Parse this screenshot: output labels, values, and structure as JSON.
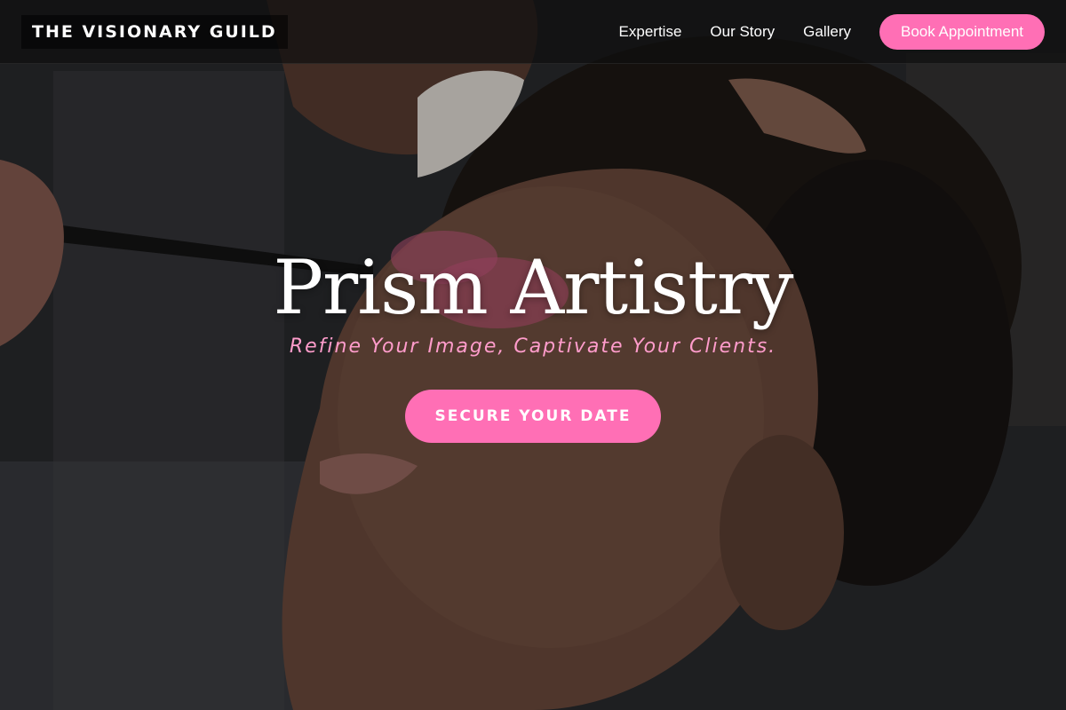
{
  "nav": {
    "brand": "THE VISIONARY GUILD",
    "links": [
      "Expertise",
      "Our Story",
      "Gallery"
    ],
    "cta_label": "Book Appointment"
  },
  "hero": {
    "title": "Prism Artistry",
    "subtitle": "Refine Your Image, Captivate Your Clients.",
    "cta_label": "SECURE YOUR DATE"
  },
  "colors": {
    "accent": "#ff6fb5",
    "subtitle": "#ff9ccb",
    "nav_bg": "#0f0f0f"
  }
}
